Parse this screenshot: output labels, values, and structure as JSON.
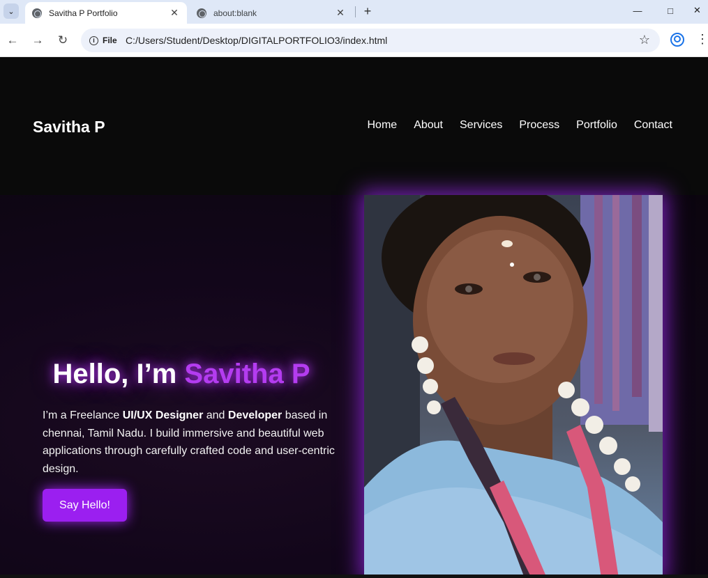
{
  "browser": {
    "tabs": [
      {
        "title": "Savitha P Portfolio",
        "active": true
      },
      {
        "title": "about:blank",
        "active": false
      }
    ],
    "new_tab_icon": "+",
    "address_chip": "File",
    "url": "C:/Users/Student/Desktop/DIGITALPORTFOLIO3/index.html",
    "window_controls": [
      "minimize-icon",
      "maximize-icon",
      "close-icon"
    ]
  },
  "site": {
    "logo": "Savitha P",
    "nav": [
      "Home",
      "About",
      "Services",
      "Process",
      "Portfolio",
      "Contact"
    ],
    "hero": {
      "greeting": "Hello, I’m ",
      "name": "Savitha P",
      "intro_1": "I’m a Freelance ",
      "role_1": "UI/UX Designer",
      "intro_2": " and ",
      "role_2": "Developer",
      "intro_3": " based in chennai, Tamil Nadu. I build immersive and beautiful web applications through carefully crafted code and user-centric design.",
      "cta": "Say Hello!"
    },
    "colors": {
      "accent": "#b43cf0",
      "button": "#9b1ff0",
      "background": "#0a0a0a"
    }
  }
}
